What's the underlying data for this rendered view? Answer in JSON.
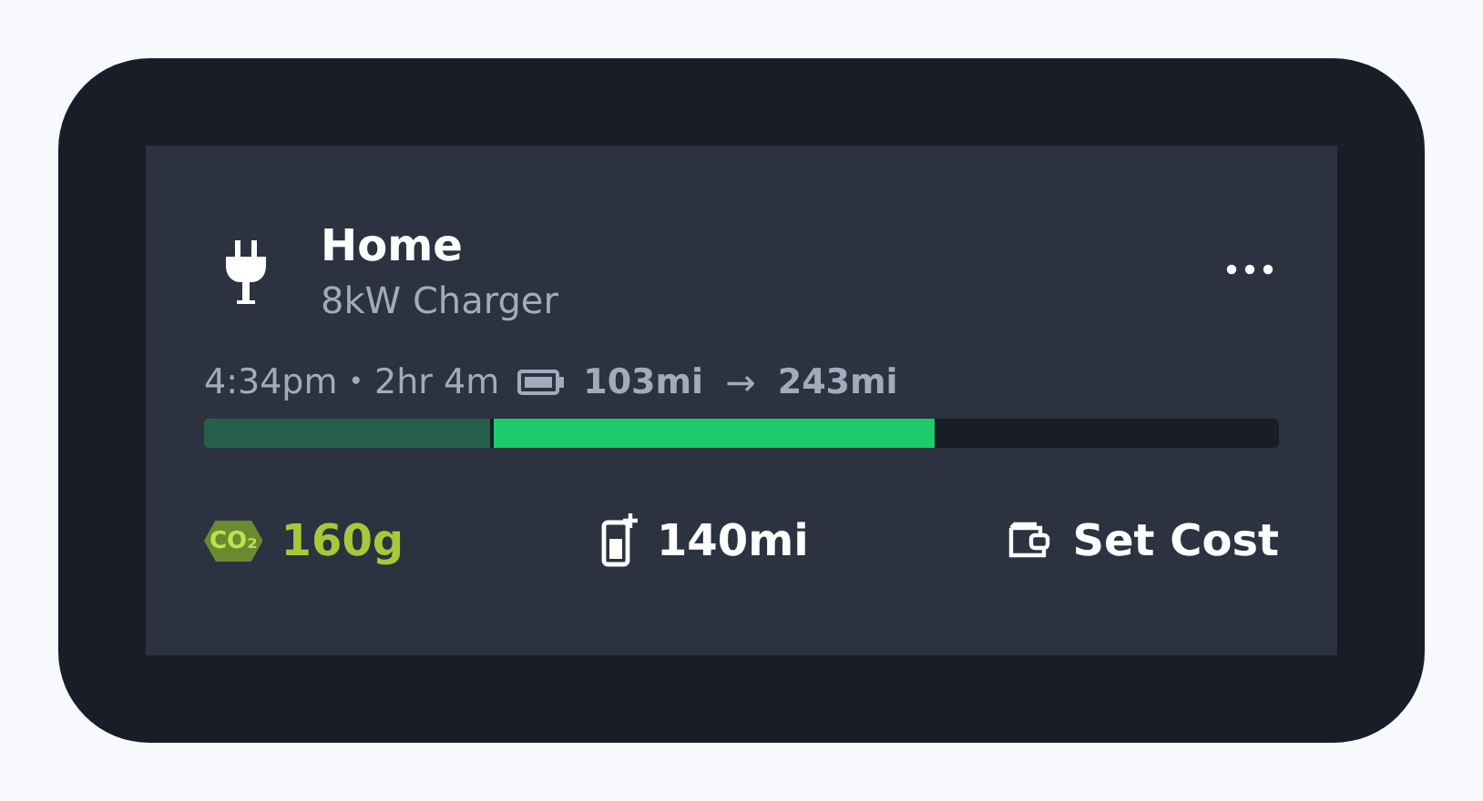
{
  "charger": {
    "title": "Home",
    "subtitle": "8kW Charger"
  },
  "session": {
    "time": "4:34pm",
    "separator": "•",
    "duration": "2hr 4m",
    "range_start": "103mi",
    "arrow": "→",
    "range_end": "243mi"
  },
  "charge_bar": {
    "segments": [
      {
        "kind": "added",
        "level": 0.68
      },
      {
        "kind": "existing",
        "level": 0.27
      }
    ]
  },
  "stats": [
    {
      "kind": "emissions",
      "badge": "CO₂",
      "value": "160g"
    },
    {
      "kind": "range",
      "value": "140mi"
    },
    {
      "kind": "cost",
      "value": "Set Cost"
    }
  ]
}
